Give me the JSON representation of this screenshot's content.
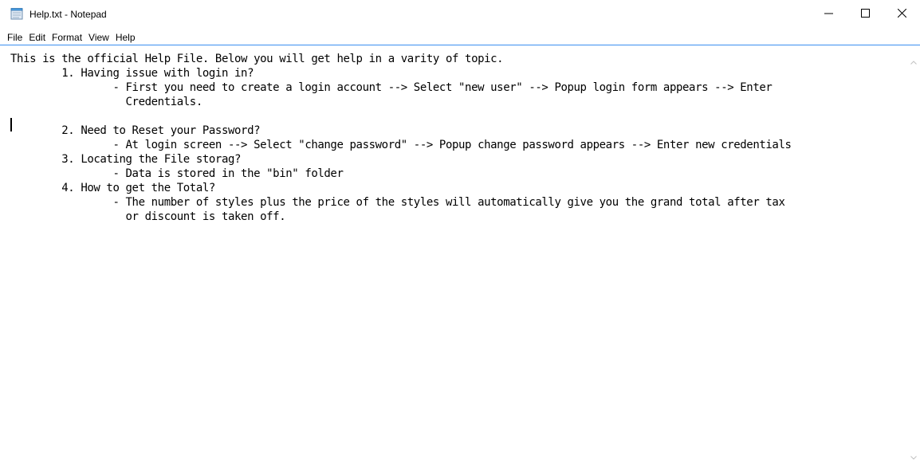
{
  "window": {
    "title": "Help.txt - Notepad",
    "app_icon": "notepad-icon",
    "controls": [
      "minimize-icon",
      "maximize-icon",
      "close-icon"
    ]
  },
  "menu": {
    "items": [
      {
        "label": "File"
      },
      {
        "label": "Edit"
      },
      {
        "label": "Format"
      },
      {
        "label": "View"
      },
      {
        "label": "Help"
      }
    ]
  },
  "document": {
    "lines": [
      "This is the official Help File. Below you will get help in a varity of topic.",
      "        1. Having issue with login in?",
      "                - First you need to create a login account --> Select \"new user\" --> Popup login form appears --> Enter",
      "                  Credentials.",
      "",
      "        2. Need to Reset your Password?",
      "                - At login screen --> Select \"change password\" --> Popup change password appears --> Enter new credentials",
      "        3. Locating the File storag?",
      "                - Data is stored in the \"bin\" folder",
      "        4. How to get the Total?",
      "                - The number of styles plus the price of the styles will automatically give you the grand total after tax",
      "                  or discount is taken off."
    ]
  },
  "colors": {
    "menu_separator": "#3a8ff0",
    "text": "#000000",
    "background": "#ffffff"
  }
}
